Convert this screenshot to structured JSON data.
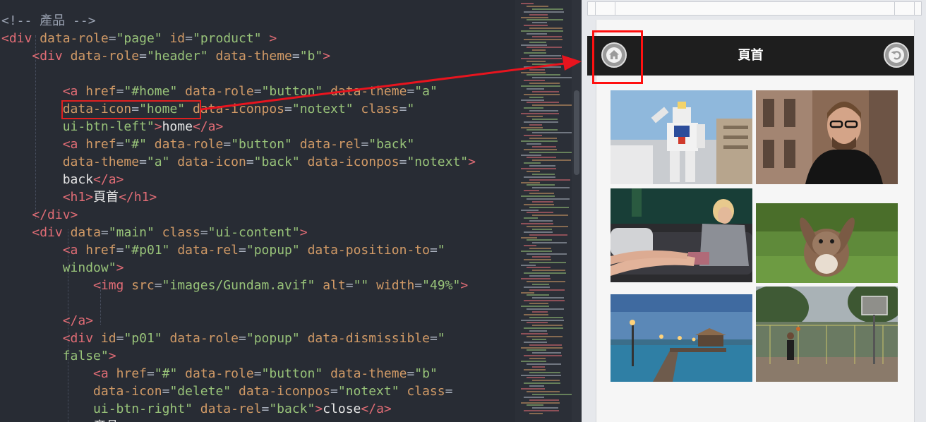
{
  "editor": {
    "lines": [
      [
        [
          "comment",
          "<!-- 產品 -->"
        ]
      ],
      [
        [
          "tag",
          "<div"
        ],
        [
          "txt",
          " "
        ],
        [
          "attr",
          "data-role"
        ],
        [
          "punct",
          "="
        ],
        [
          "str",
          "\"page\""
        ],
        [
          "txt",
          " "
        ],
        [
          "attr",
          "id"
        ],
        [
          "punct",
          "="
        ],
        [
          "str",
          "\"product\""
        ],
        [
          "txt",
          " "
        ],
        [
          "tag",
          ">"
        ]
      ],
      [
        [
          "txt",
          "    "
        ],
        [
          "tag",
          "<div"
        ],
        [
          "txt",
          " "
        ],
        [
          "attr",
          "data-role"
        ],
        [
          "punct",
          "="
        ],
        [
          "str",
          "\"header\""
        ],
        [
          "txt",
          " "
        ],
        [
          "attr",
          "data-theme"
        ],
        [
          "punct",
          "="
        ],
        [
          "str",
          "\"b\""
        ],
        [
          "tag",
          ">"
        ]
      ],
      [
        [
          "txt",
          ""
        ]
      ],
      [
        [
          "txt",
          "        "
        ],
        [
          "tag",
          "<a"
        ],
        [
          "txt",
          " "
        ],
        [
          "attr",
          "href"
        ],
        [
          "punct",
          "="
        ],
        [
          "str",
          "\"#home\""
        ],
        [
          "txt",
          " "
        ],
        [
          "attr",
          "data-role"
        ],
        [
          "punct",
          "="
        ],
        [
          "str",
          "\"button\""
        ],
        [
          "txt",
          " "
        ],
        [
          "attr",
          "data-theme"
        ],
        [
          "punct",
          "="
        ],
        [
          "str",
          "\"a\""
        ]
      ],
      [
        [
          "txt",
          "        "
        ],
        [
          "attr",
          "data-icon"
        ],
        [
          "punct",
          "="
        ],
        [
          "str",
          "\"home\""
        ],
        [
          "txt",
          " "
        ],
        [
          "attr",
          "data-iconpos"
        ],
        [
          "punct",
          "="
        ],
        [
          "str",
          "\"notext\""
        ],
        [
          "txt",
          " "
        ],
        [
          "attr",
          "class"
        ],
        [
          "punct",
          "="
        ],
        [
          "str",
          "\""
        ]
      ],
      [
        [
          "txt",
          "        "
        ],
        [
          "str",
          "ui-btn-left\""
        ],
        [
          "tag",
          ">"
        ],
        [
          "txt",
          "home"
        ],
        [
          "tag",
          "</a>"
        ]
      ],
      [
        [
          "txt",
          "        "
        ],
        [
          "tag",
          "<a"
        ],
        [
          "txt",
          " "
        ],
        [
          "attr",
          "href"
        ],
        [
          "punct",
          "="
        ],
        [
          "str",
          "\"#\""
        ],
        [
          "txt",
          " "
        ],
        [
          "attr",
          "data-role"
        ],
        [
          "punct",
          "="
        ],
        [
          "str",
          "\"button\""
        ],
        [
          "txt",
          " "
        ],
        [
          "attr",
          "data-rel"
        ],
        [
          "punct",
          "="
        ],
        [
          "str",
          "\"back\""
        ]
      ],
      [
        [
          "txt",
          "        "
        ],
        [
          "attr",
          "data-theme"
        ],
        [
          "punct",
          "="
        ],
        [
          "str",
          "\"a\""
        ],
        [
          "txt",
          " "
        ],
        [
          "attr",
          "data-icon"
        ],
        [
          "punct",
          "="
        ],
        [
          "str",
          "\"back\""
        ],
        [
          "txt",
          " "
        ],
        [
          "attr",
          "data-iconpos"
        ],
        [
          "punct",
          "="
        ],
        [
          "str",
          "\"notext\""
        ],
        [
          "tag",
          ">"
        ]
      ],
      [
        [
          "txt",
          "        back"
        ],
        [
          "tag",
          "</a>"
        ]
      ],
      [
        [
          "txt",
          "        "
        ],
        [
          "tag",
          "<h1>"
        ],
        [
          "txt",
          "頁首"
        ],
        [
          "tag",
          "</h1>"
        ]
      ],
      [
        [
          "txt",
          "    "
        ],
        [
          "tag",
          "</div>"
        ]
      ],
      [
        [
          "txt",
          "    "
        ],
        [
          "tag",
          "<div"
        ],
        [
          "txt",
          " "
        ],
        [
          "attr",
          "data"
        ],
        [
          "punct",
          "="
        ],
        [
          "str",
          "\"main\""
        ],
        [
          "txt",
          " "
        ],
        [
          "attr",
          "class"
        ],
        [
          "punct",
          "="
        ],
        [
          "str",
          "\"ui-content\""
        ],
        [
          "tag",
          ">"
        ]
      ],
      [
        [
          "txt",
          "        "
        ],
        [
          "tag",
          "<a"
        ],
        [
          "txt",
          " "
        ],
        [
          "attr",
          "href"
        ],
        [
          "punct",
          "="
        ],
        [
          "str",
          "\"#p01\""
        ],
        [
          "txt",
          " "
        ],
        [
          "attr",
          "data-rel"
        ],
        [
          "punct",
          "="
        ],
        [
          "str",
          "\"popup\""
        ],
        [
          "txt",
          " "
        ],
        [
          "attr",
          "data-position-to"
        ],
        [
          "punct",
          "="
        ],
        [
          "str",
          "\""
        ]
      ],
      [
        [
          "txt",
          "        "
        ],
        [
          "str",
          "window\""
        ],
        [
          "tag",
          ">"
        ]
      ],
      [
        [
          "txt",
          "            "
        ],
        [
          "tag",
          "<img"
        ],
        [
          "txt",
          " "
        ],
        [
          "attr",
          "src"
        ],
        [
          "punct",
          "="
        ],
        [
          "str",
          "\"images/Gundam.avif\""
        ],
        [
          "txt",
          " "
        ],
        [
          "attr",
          "alt"
        ],
        [
          "punct",
          "="
        ],
        [
          "str",
          "\"\""
        ],
        [
          "txt",
          " "
        ],
        [
          "attr",
          "width"
        ],
        [
          "punct",
          "="
        ],
        [
          "str",
          "\"49%\""
        ],
        [
          "tag",
          ">"
        ]
      ],
      [
        [
          "txt",
          ""
        ]
      ],
      [
        [
          "txt",
          "        "
        ],
        [
          "tag",
          "</a>"
        ]
      ],
      [
        [
          "txt",
          "        "
        ],
        [
          "tag",
          "<div"
        ],
        [
          "txt",
          " "
        ],
        [
          "attr",
          "id"
        ],
        [
          "punct",
          "="
        ],
        [
          "str",
          "\"p01\""
        ],
        [
          "txt",
          " "
        ],
        [
          "attr",
          "data-role"
        ],
        [
          "punct",
          "="
        ],
        [
          "str",
          "\"popup\""
        ],
        [
          "txt",
          " "
        ],
        [
          "attr",
          "data-dismissible"
        ],
        [
          "punct",
          "="
        ],
        [
          "str",
          "\""
        ]
      ],
      [
        [
          "txt",
          "        "
        ],
        [
          "str",
          "false\""
        ],
        [
          "tag",
          ">"
        ]
      ],
      [
        [
          "txt",
          "            "
        ],
        [
          "tag",
          "<a"
        ],
        [
          "txt",
          " "
        ],
        [
          "attr",
          "href"
        ],
        [
          "punct",
          "="
        ],
        [
          "str",
          "\"#\""
        ],
        [
          "txt",
          " "
        ],
        [
          "attr",
          "data-role"
        ],
        [
          "punct",
          "="
        ],
        [
          "str",
          "\"button\""
        ],
        [
          "txt",
          " "
        ],
        [
          "attr",
          "data-theme"
        ],
        [
          "punct",
          "="
        ],
        [
          "str",
          "\"b\""
        ]
      ],
      [
        [
          "txt",
          "            "
        ],
        [
          "attr",
          "data-icon"
        ],
        [
          "punct",
          "="
        ],
        [
          "str",
          "\"delete\""
        ],
        [
          "txt",
          " "
        ],
        [
          "attr",
          "data-iconpos"
        ],
        [
          "punct",
          "="
        ],
        [
          "str",
          "\"notext\""
        ],
        [
          "txt",
          " "
        ],
        [
          "attr",
          "class"
        ],
        [
          "punct",
          "="
        ]
      ],
      [
        [
          "txt",
          "            "
        ],
        [
          "str",
          "ui-btn-right\""
        ],
        [
          "txt",
          " "
        ],
        [
          "attr",
          "data-rel"
        ],
        [
          "punct",
          "="
        ],
        [
          "str",
          "\"back\""
        ],
        [
          "tag",
          ">"
        ],
        [
          "txt",
          "close"
        ],
        [
          "tag",
          "</a>"
        ]
      ],
      [
        [
          "txt",
          "            "
        ],
        [
          "txt",
          "產品"
        ]
      ]
    ]
  },
  "preview": {
    "header_title": "頁首",
    "home_button_icon": "home-icon",
    "back_button_icon": "back-arrow-icon",
    "gallery": [
      {
        "name": "gundam-robot-photo"
      },
      {
        "name": "man-with-glasses-photo"
      },
      {
        "name": "woman-on-phone-sofa-photo"
      },
      {
        "name": "rabbit-on-grass-photo"
      },
      {
        "name": "lake-pier-dusk-photo"
      },
      {
        "name": "basketball-court-photo"
      }
    ]
  },
  "colors": {
    "editor_bg": "#282c34",
    "tag": "#e06c75",
    "attribute": "#d19a66",
    "string": "#98c379",
    "highlight_box": "#e02020",
    "header_bar": "#1e1e1e"
  }
}
